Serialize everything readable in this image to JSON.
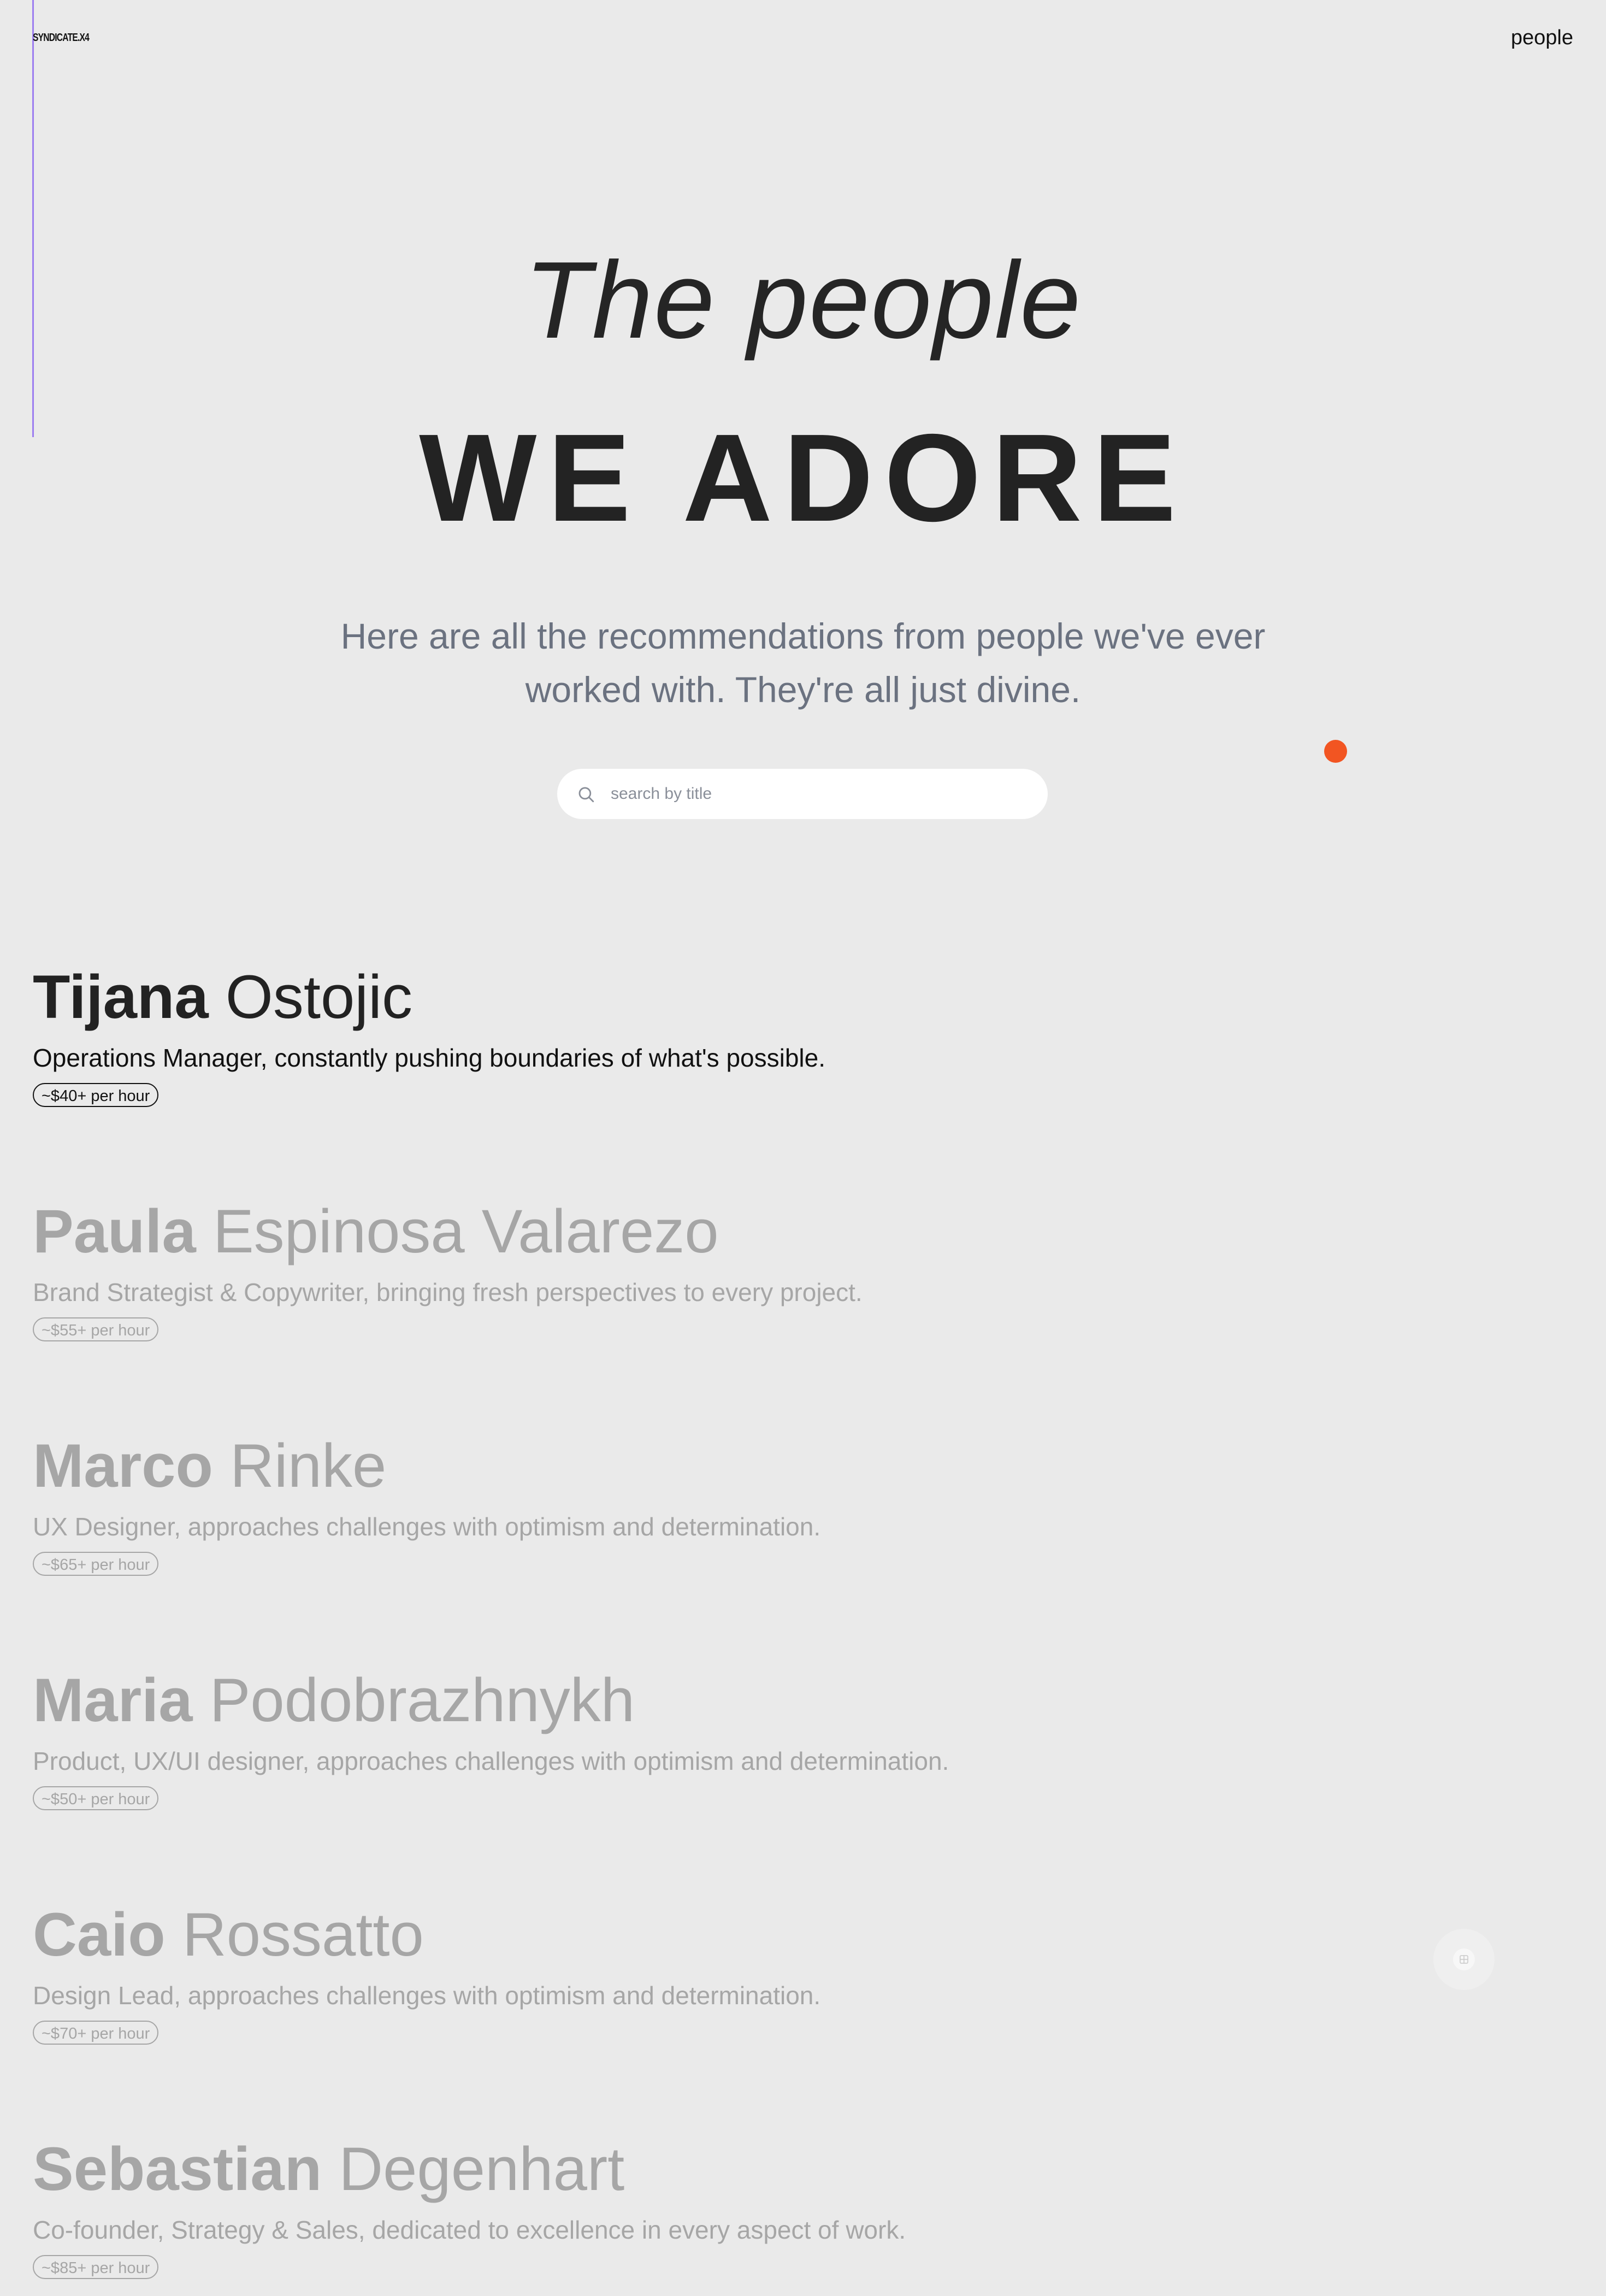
{
  "header": {
    "logo": "SYNDICATE.X4",
    "nav_link": "people"
  },
  "hero": {
    "title_line1": "The people",
    "title_line2": "WE ADORE",
    "subtitle": "Here are all the recommendations from people we've ever worked with. They're all just divine."
  },
  "search": {
    "placeholder": "search by title",
    "value": ""
  },
  "people": [
    {
      "first": "Tijana",
      "last": "Ostojic",
      "description": "Operations Manager, constantly pushing boundaries of what's possible.",
      "rate": "~$40+ per hour"
    },
    {
      "first": "Paula",
      "last": "Espinosa Valarezo",
      "description": "Brand Strategist & Copywriter, bringing fresh perspectives to every project.",
      "rate": "~$55+ per hour"
    },
    {
      "first": "Marco",
      "last": "Rinke",
      "description": "UX Designer, approaches challenges with optimism and determination.",
      "rate": "~$65+ per hour"
    },
    {
      "first": "Maria",
      "last": "Podobrazhnykh",
      "description": "Product, UX/UI designer, approaches challenges with optimism and determination.",
      "rate": "~$50+ per hour"
    },
    {
      "first": "Caio",
      "last": "Rossatto",
      "description": "Design Lead, approaches challenges with optimism and determination.",
      "rate": "~$70+ per hour"
    },
    {
      "first": "Sebastian",
      "last": "Degenhart",
      "description": "Co-founder, Strategy & Sales, dedicated to excellence in every aspect of work.",
      "rate": "~$85+ per hour"
    }
  ],
  "colors": {
    "background": "#eaeaea",
    "accent_dot": "#f25522",
    "brand_line": "#9d7ef0",
    "subtitle": "#6b7280",
    "dimmed_text": "#a6a6a6"
  },
  "icons": {
    "search": "search-icon",
    "floating": "grid-icon"
  }
}
